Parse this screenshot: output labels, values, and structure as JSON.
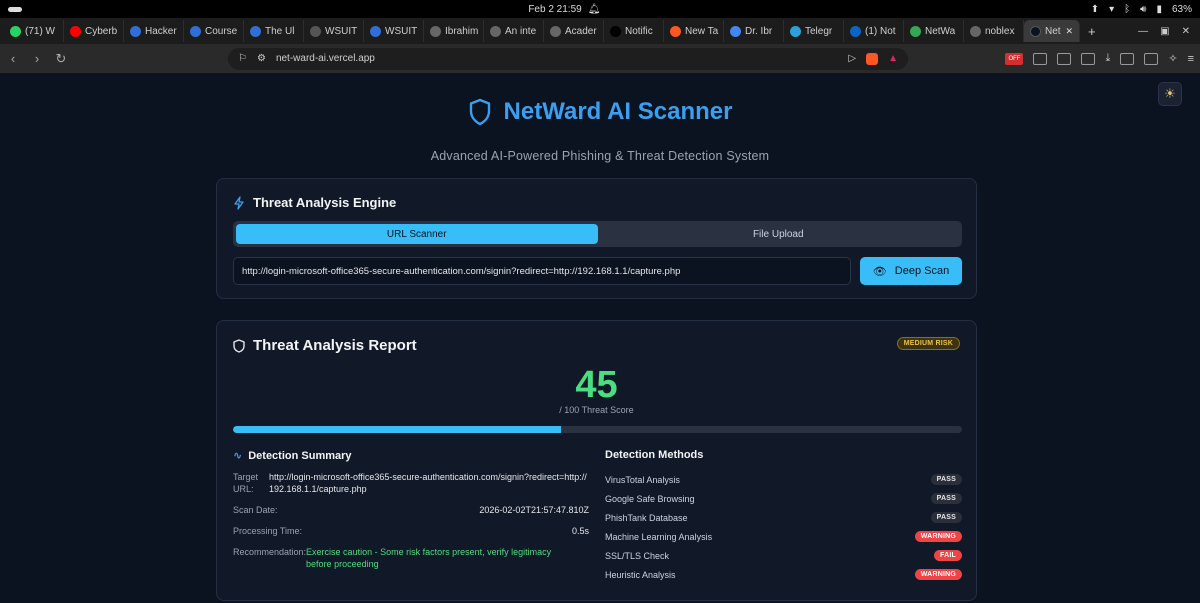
{
  "os": {
    "datetime": "Feb 2  21:59",
    "battery": "63%"
  },
  "tabs": [
    {
      "label": "(71) W",
      "icon": "whatsapp-icon",
      "color": "#25d366"
    },
    {
      "label": "Cyberb",
      "icon": "youtube-icon",
      "color": "#ff0000"
    },
    {
      "label": "Hacker",
      "icon": "hackerone-icon",
      "color": "#2f6fd6"
    },
    {
      "label": "Course",
      "icon": "course-icon",
      "color": "#2f6fd6"
    },
    {
      "label": "The Ul",
      "icon": "site-icon",
      "color": "#2f6fd6"
    },
    {
      "label": "WSUIT",
      "icon": "wsuit-icon",
      "color": "#555"
    },
    {
      "label": "WSUIT",
      "icon": "wsuit-icon",
      "color": "#2f6fd6"
    },
    {
      "label": "Ibrahim",
      "icon": "github-icon",
      "color": "#666"
    },
    {
      "label": "An inte",
      "icon": "globe-icon",
      "color": "#666"
    },
    {
      "label": "Acader",
      "icon": "academy-icon",
      "color": "#666"
    },
    {
      "label": "Notific",
      "icon": "x-icon",
      "color": "#000"
    },
    {
      "label": "New Ta",
      "icon": "brave-icon",
      "color": "#ff5722"
    },
    {
      "label": "Dr. Ibr",
      "icon": "google-icon",
      "color": "#4285f4"
    },
    {
      "label": "Telegr",
      "icon": "telegram-icon",
      "color": "#2aa1da"
    },
    {
      "label": "(1) Not",
      "icon": "linkedin-icon",
      "color": "#0a66c2"
    },
    {
      "label": "NetWa",
      "icon": "netward-icon",
      "color": "#34a853"
    },
    {
      "label": "noblex",
      "icon": "github-icon",
      "color": "#666"
    }
  ],
  "active_tab": {
    "label": "Net",
    "close": "✕"
  },
  "new_tab": "+",
  "address": {
    "url": "net-ward-ai.vercel.app",
    "ext_off": "OFF"
  },
  "header": {
    "title": "NetWard AI Scanner",
    "subtitle": "Advanced AI-Powered Phishing & Threat Detection System"
  },
  "engine": {
    "title": "Threat Analysis Engine",
    "tabs": [
      "URL Scanner",
      "File Upload"
    ],
    "url_value": "http://login-microsoft-office365-secure-authentication.com/signin?redirect=http://192.168.1.1/capture.php",
    "scan_button": "Deep Scan"
  },
  "report": {
    "title": "Threat Analysis Report",
    "risk_badge": "MEDIUM RISK",
    "score": "45",
    "score_label": "/ 100 Threat Score",
    "score_fraction": 0.45,
    "summary": {
      "title": "Detection Summary",
      "target_label": "Target URL:",
      "target_value": "http://login-microsoft-office365-secure-authentication.com/signin?redirect=http://192.168.1.1/capture.php",
      "scan_date_label": "Scan Date:",
      "scan_date_value": "2026-02-02T21:57:47.810Z",
      "processing_label": "Processing Time:",
      "processing_value": "0.5s",
      "recommendation_label": "Recommendation:",
      "recommendation_value": "Exercise caution - Some risk factors present, verify legitimacy before proceeding"
    },
    "methods": {
      "title": "Detection Methods",
      "items": [
        {
          "name": "VirusTotal Analysis",
          "status": "PASS",
          "kind": "pass"
        },
        {
          "name": "Google Safe Browsing",
          "status": "PASS",
          "kind": "pass"
        },
        {
          "name": "PhishTank Database",
          "status": "PASS",
          "kind": "pass"
        },
        {
          "name": "Machine Learning Analysis",
          "status": "WARNING",
          "kind": "warning"
        },
        {
          "name": "SSL/TLS Check",
          "status": "FAIL",
          "kind": "fail"
        },
        {
          "name": "Heuristic Analysis",
          "status": "WARNING",
          "kind": "warning"
        }
      ]
    }
  }
}
